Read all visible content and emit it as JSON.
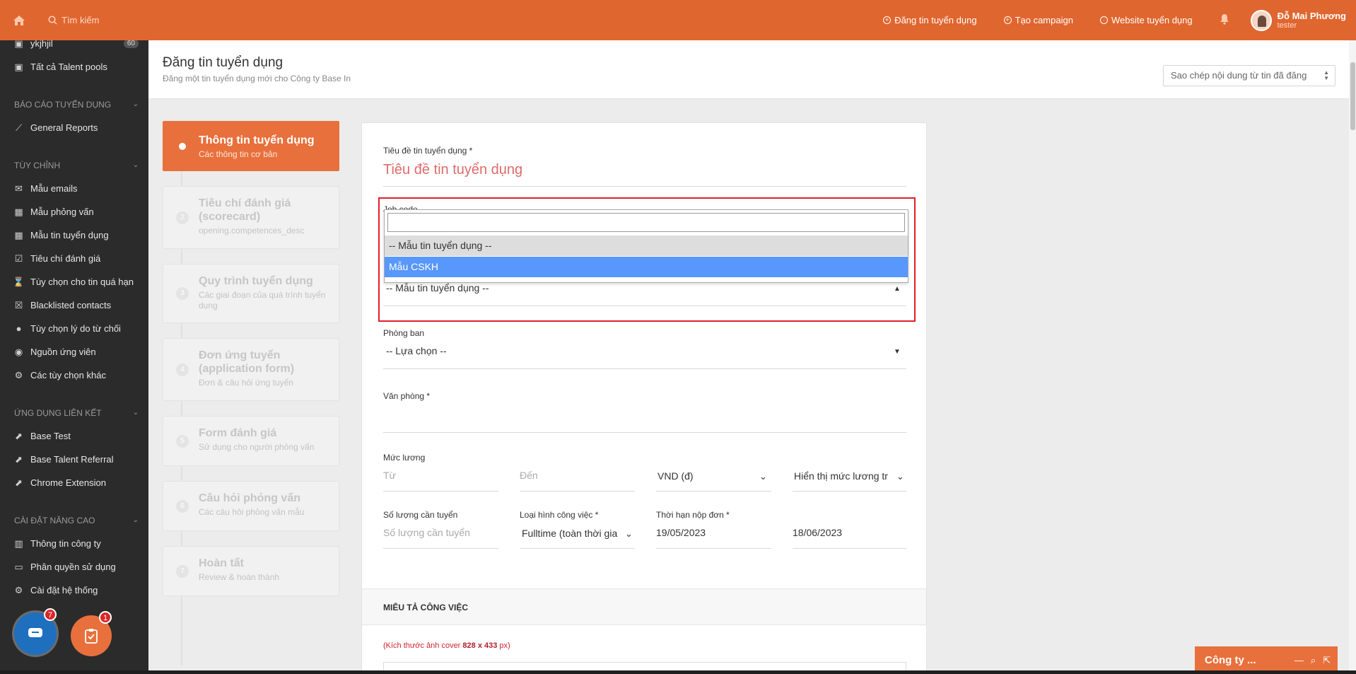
{
  "topbar": {
    "search_placeholder": "Tìm kiếm",
    "links": [
      "Đăng tin tuyển dụng",
      "Tạo campaign",
      "Website tuyển dụng"
    ],
    "user_name": "Đỗ Mai Phương",
    "user_role": "tester"
  },
  "sidebar": {
    "top_items": [
      {
        "label": "ykjhjil",
        "badge": "60"
      },
      {
        "label": "Tất cả Talent pools"
      }
    ],
    "sections": [
      {
        "title": "BÁO CÁO TUYỂN DỤNG",
        "items": [
          "General Reports"
        ]
      },
      {
        "title": "TÙY CHỈNH",
        "items": [
          "Mẫu emails",
          "Mẫu phỏng vấn",
          "Mẫu tin tuyển dụng",
          "Tiêu chí đánh giá",
          "Tùy chọn cho tin quá hạn",
          "Blacklisted contacts",
          "Tùy chọn lý do từ chối",
          "Nguồn ứng viên",
          "Các tùy chọn khác"
        ]
      },
      {
        "title": "ỨNG DỤNG LIÊN KẾT",
        "items": [
          "Base Test",
          "Base Talent Referral",
          "Chrome Extension"
        ]
      },
      {
        "title": "CÀI ĐẶT NÂNG CAO",
        "items": [
          "Thông tin công ty",
          "Phân quyền sử dụng",
          "Cài đặt hệ thống"
        ]
      }
    ],
    "fab_chat_count": "7",
    "fab_task_count": "1"
  },
  "page": {
    "title": "Đăng tin tuyển dụng",
    "subtitle": "Đăng một tin tuyển dụng mới cho Công ty Base In",
    "copy_select": "Sao chép nội dung từ tin đã đăng"
  },
  "steps": [
    {
      "num": "",
      "title": "Thông tin tuyển dụng",
      "desc": "Các thông tin cơ bản",
      "active": true
    },
    {
      "num": "2",
      "title": "Tiêu chí đánh giá (scorecard)",
      "desc": "opening.competences_desc"
    },
    {
      "num": "3",
      "title": "Quy trình tuyển dụng",
      "desc": "Các giai đoạn của quá trình tuyển dụng"
    },
    {
      "num": "4",
      "title": "Đơn ứng tuyển (application form)",
      "desc": "Đơn & câu hỏi ứng tuyển"
    },
    {
      "num": "5",
      "title": "Form đánh giá",
      "desc": "Sử dụng cho người phỏng vấn"
    },
    {
      "num": "6",
      "title": "Câu hỏi phỏng vấn",
      "desc": "Các câu hỏi phỏng vấn mẫu"
    },
    {
      "num": "7",
      "title": "Hoàn tất",
      "desc": "Review & hoàn thành"
    }
  ],
  "form": {
    "job_title_label": "Tiêu đề tin tuyển dụng *",
    "job_title_placeholder": "Tiêu đề tin tuyển dụng",
    "job_code_label": "Job code",
    "template_options": [
      "-- Mẫu tin tuyển dụng --",
      "Mẫu CSKH"
    ],
    "template_value": "-- Mẫu tin tuyển dụng --",
    "department_label": "Phòng ban",
    "department_value": "-- Lựa chọn --",
    "office_label": "Văn phòng *",
    "salary_label": "Mức lương",
    "salary_from": "Từ",
    "salary_to": "Đến",
    "currency": "VND (đ)",
    "salary_display": "Hiển thị mức lương tr",
    "quantity_label": "Số lượng cần tuyển",
    "quantity_placeholder": "Số lượng cần tuyển",
    "job_type_label": "Loại hình công việc *",
    "job_type_value": "Fulltime (toàn thời gia",
    "deadline_label": "Thời hạn nộp đơn *",
    "deadline_from": "19/05/2023",
    "deadline_to": "18/06/2023",
    "section_description": "MIÊU TẢ CÔNG VIỆC",
    "cover_note_prefix": "(Kích thước ảnh cover ",
    "cover_note_size": "828 x 433",
    "cover_note_suffix": " px)"
  },
  "chat_widget": {
    "title": "Công ty ..."
  }
}
